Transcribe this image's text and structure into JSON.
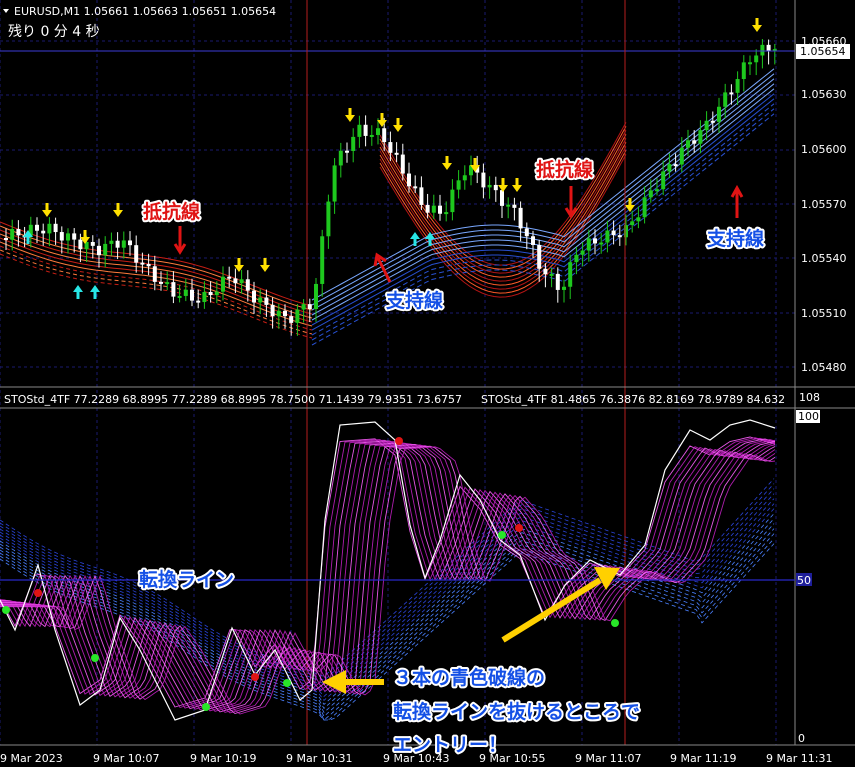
{
  "header": {
    "symbol_line": "EURUSD,M1  1.05661 1.05663 1.05651 1.05654",
    "timer": "残り 0 分 4 秒"
  },
  "price_axis": {
    "ticks": [
      "1.05660",
      "1.05630",
      "1.05600",
      "1.05570",
      "1.05540",
      "1.05510",
      "1.05480"
    ],
    "current_price": "1.05654"
  },
  "indicator": {
    "label_left": "STOStd_4TF 77.2289 68.8995 77.2289 68.8995 78.7500 71.1439 79.9351 73.6757",
    "label_right": "STOStd_4TF 81.4865 76.3876 82.8169 78.9789 84.632",
    "axis_top": "108",
    "axis_100": "100",
    "axis_50": "50",
    "axis_0": "0"
  },
  "time_axis": [
    "9 Mar 2023",
    "9 Mar 10:07",
    "9 Mar 10:19",
    "9 Mar 10:31",
    "9 Mar 10:43",
    "9 Mar 10:55",
    "9 Mar 11:07",
    "9 Mar 11:19",
    "9 Mar 11:31"
  ],
  "annotations": {
    "resistance": "抵抗線",
    "support": "支持線",
    "turn_line": "転換ライン",
    "note_line1": "３本の青色破線の",
    "note_line2": "転換ラインを抜けるところで",
    "note_line3": "エントリー！"
  },
  "colors": {
    "background": "#000000",
    "bull_candle": "#1ec81e",
    "bear_candle": "#ffffff",
    "resistance_band": "#e03c1e",
    "support_band": "#3c78ff",
    "stoch_magenta": "#e040e0",
    "vertical_marker": "#b41e1e",
    "annotation_red": "#e01414",
    "annotation_blue": "#1450e6",
    "arrow_yellow": "#ffd000"
  }
}
